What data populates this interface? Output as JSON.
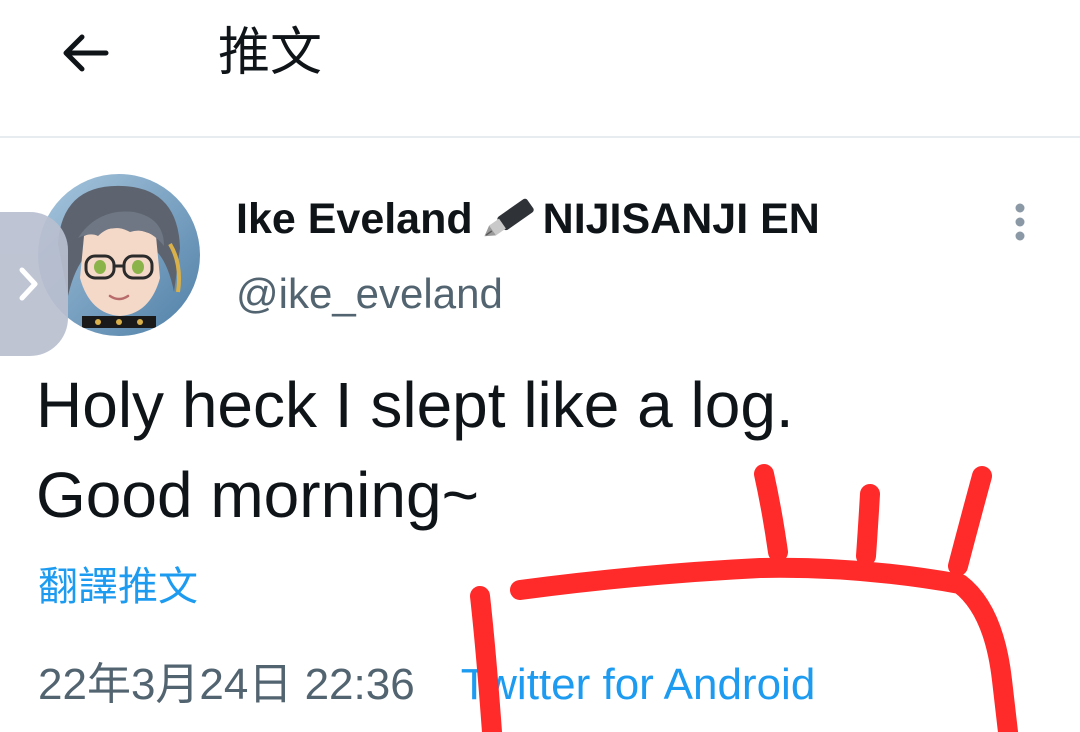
{
  "header": {
    "title": "推文"
  },
  "tweet": {
    "display_name": "Ike Eveland",
    "display_name_suffix": "NIJISANJI EN",
    "handle": "@ike_eveland",
    "text": "Holy heck I slept like a log.\nGood morning~",
    "translate_label": "翻譯推文",
    "timestamp": "22年3月24日 22:36",
    "source": "Twitter for Android"
  },
  "icons": {
    "back": "arrow-left-icon",
    "more": "more-vertical-icon",
    "side": "chevron-right-icon",
    "name_emoji": "fountain-pen-icon"
  },
  "colors": {
    "link": "#1d9bf0",
    "secondary_text": "#536471",
    "annotation": "#ff2a2a"
  }
}
